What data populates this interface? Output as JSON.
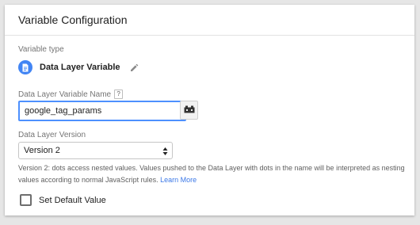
{
  "card": {
    "title": "Variable Configuration"
  },
  "variable_type": {
    "label": "Variable type",
    "name": "Data Layer Variable",
    "icon": "document-icon",
    "icon_color": "#4285f4"
  },
  "variable_name": {
    "label": "Data Layer Variable Name",
    "help": "?",
    "value": "google_tag_params",
    "focus_color": "#4d90fe"
  },
  "version": {
    "label": "Data Layer Version",
    "selected": "Version 2",
    "help_text": "Version 2: dots access nested values. Values pushed to the Data Layer with dots in the name will be interpreted as nesting values according to normal JavaScript rules.",
    "learn_more": "Learn More",
    "link_color": "#3b78e7"
  },
  "default_value": {
    "label": "Set Default Value",
    "checked": false
  }
}
